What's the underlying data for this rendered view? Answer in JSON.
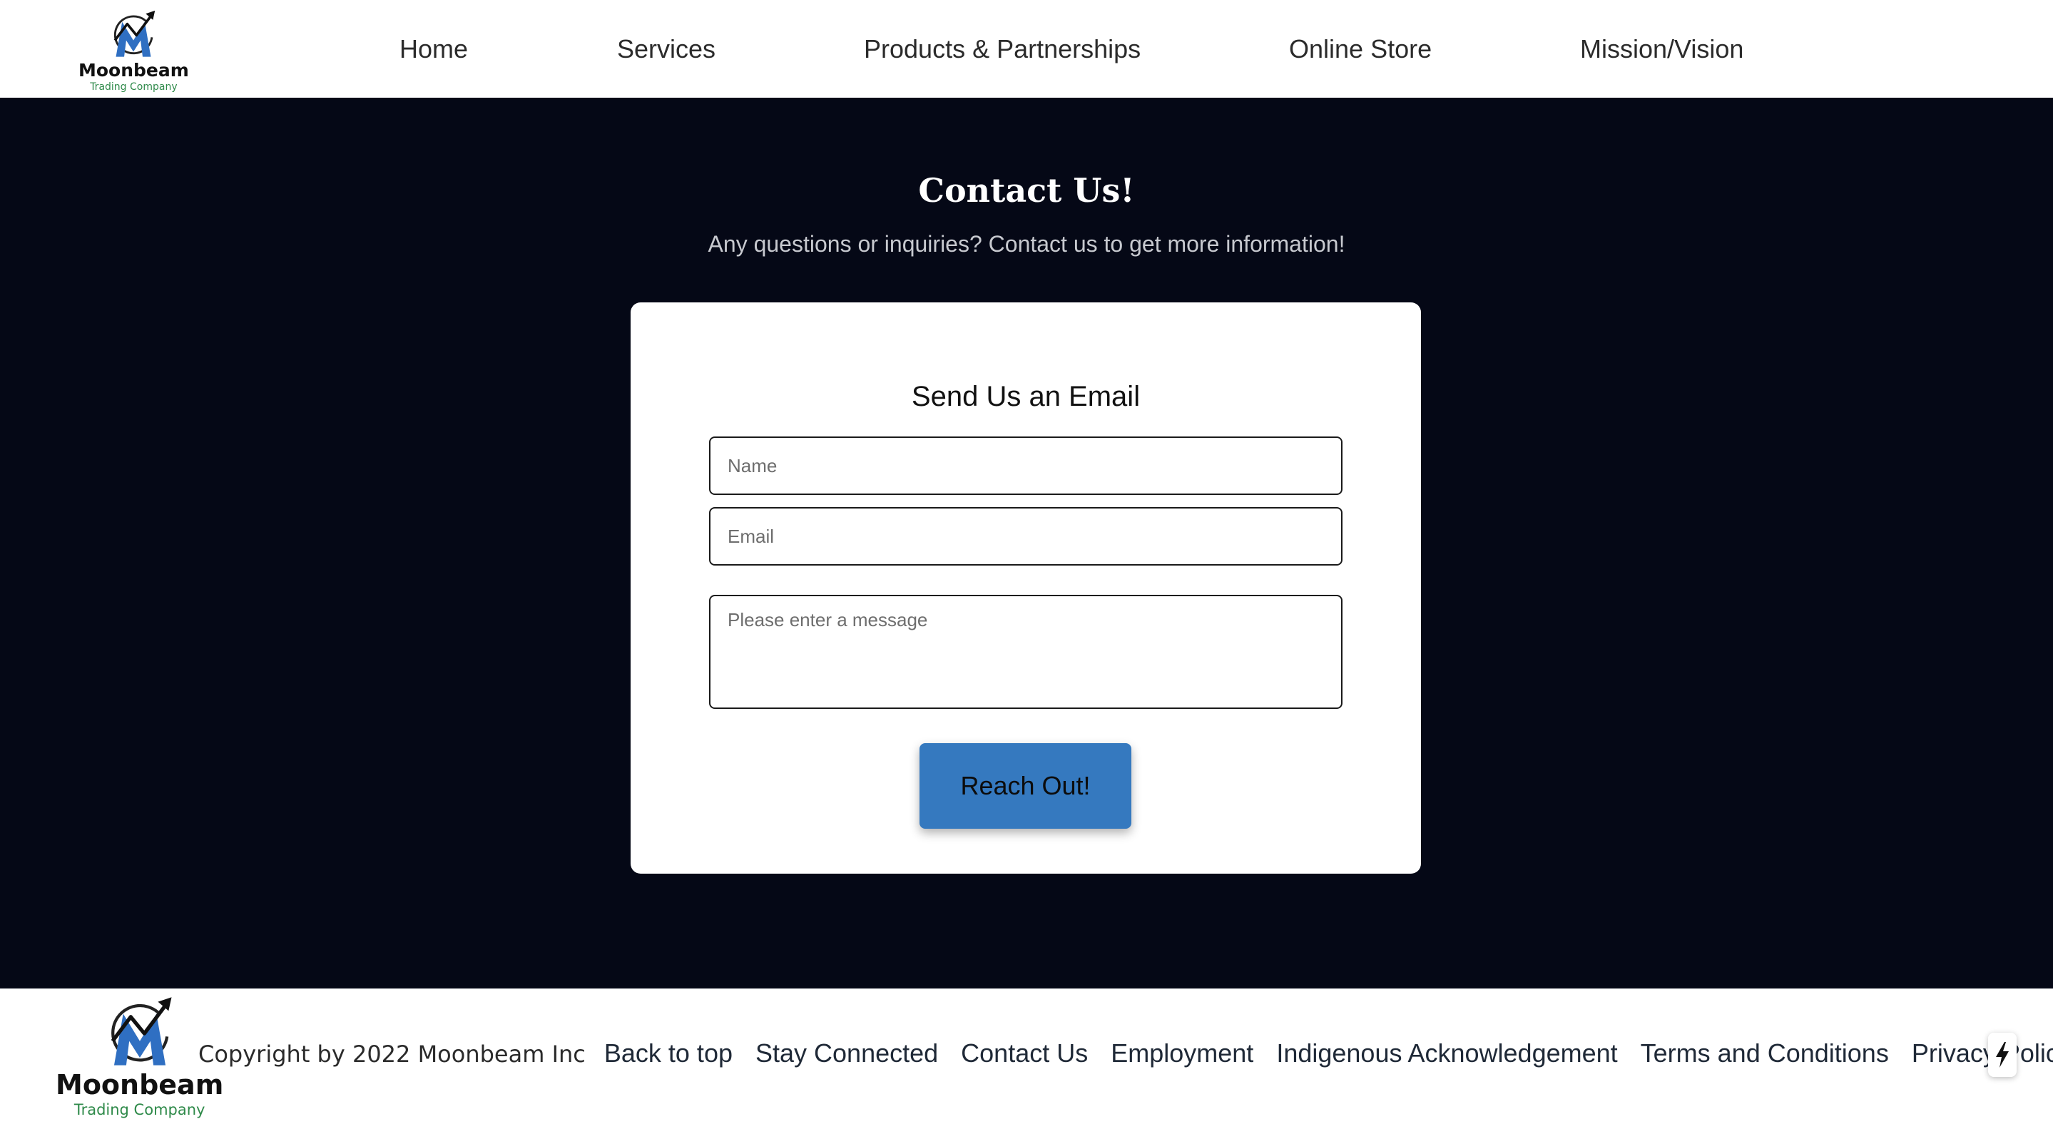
{
  "header": {
    "logo": {
      "brand": "Moonbeam",
      "tagline": "Trading Company",
      "icon": "moonbeam-logo-icon"
    },
    "nav": [
      {
        "label": "Home"
      },
      {
        "label": "Services"
      },
      {
        "label": "Products & Partnerships"
      },
      {
        "label": "Online Store"
      },
      {
        "label": "Mission/Vision"
      }
    ]
  },
  "main": {
    "title": "Contact Us!",
    "subtitle": "Any questions or inquiries? Contact us to get more information!",
    "form": {
      "title": "Send Us an Email",
      "name_placeholder": "Name",
      "email_placeholder": "Email",
      "message_placeholder": "Please enter a message",
      "submit_label": "Reach Out!"
    }
  },
  "footer": {
    "logo": {
      "brand": "Moonbeam",
      "tagline": "Trading Company",
      "icon": "moonbeam-logo-icon"
    },
    "copyright": "Copyright by 2022 Moonbeam Inc",
    "links": [
      {
        "label": "Back to top"
      },
      {
        "label": "Stay Connected"
      },
      {
        "label": "Contact Us"
      },
      {
        "label": "Employment"
      },
      {
        "label": "Indigenous Acknowledgement"
      },
      {
        "label": "Terms and Conditions"
      },
      {
        "label": "Privacy Policy"
      }
    ],
    "badge_icon": "lightning-bolt-icon"
  },
  "colors": {
    "page_background": "#050816",
    "accent_button": "#3579bf",
    "logo_blue": "#2f6fc2",
    "logo_green": "#2f8a4a"
  }
}
